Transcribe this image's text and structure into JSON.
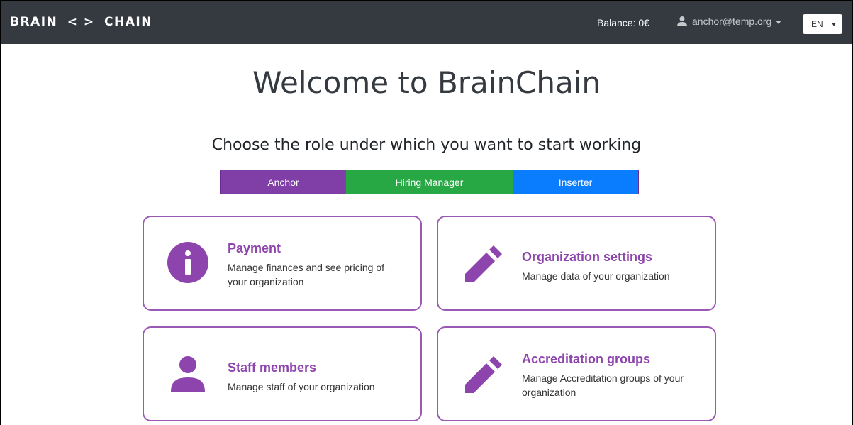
{
  "navbar": {
    "brand_part1": "Brain",
    "brand_sep": "< >",
    "brand_part2": "Chain",
    "balance": "Balance: 0€",
    "user_email": "anchor@temp.org",
    "language": "EN"
  },
  "main": {
    "title": "Welcome to BrainChain",
    "subtitle": "Choose the role under which you want to start working"
  },
  "roles": [
    {
      "label": "Anchor",
      "color": "#7f3fa6"
    },
    {
      "label": "Hiring Manager",
      "color": "#28a745"
    },
    {
      "label": "Inserter",
      "color": "#0a7dff"
    }
  ],
  "cards": [
    {
      "icon": "info-icon",
      "title": "Payment",
      "description": "Manage finances and see pricing of your organization"
    },
    {
      "icon": "pencil-icon",
      "title": "Organization settings",
      "description": "Manage data of your organization"
    },
    {
      "icon": "user-icon",
      "title": "Staff members",
      "description": "Manage staff of your organization"
    },
    {
      "icon": "pencil-icon",
      "title": "Accreditation groups",
      "description": "Manage Accreditation groups of your organization"
    }
  ],
  "colors": {
    "navbar_bg": "#343a40",
    "accent_purple": "#8e44ad",
    "card_border": "#9b59b6"
  }
}
